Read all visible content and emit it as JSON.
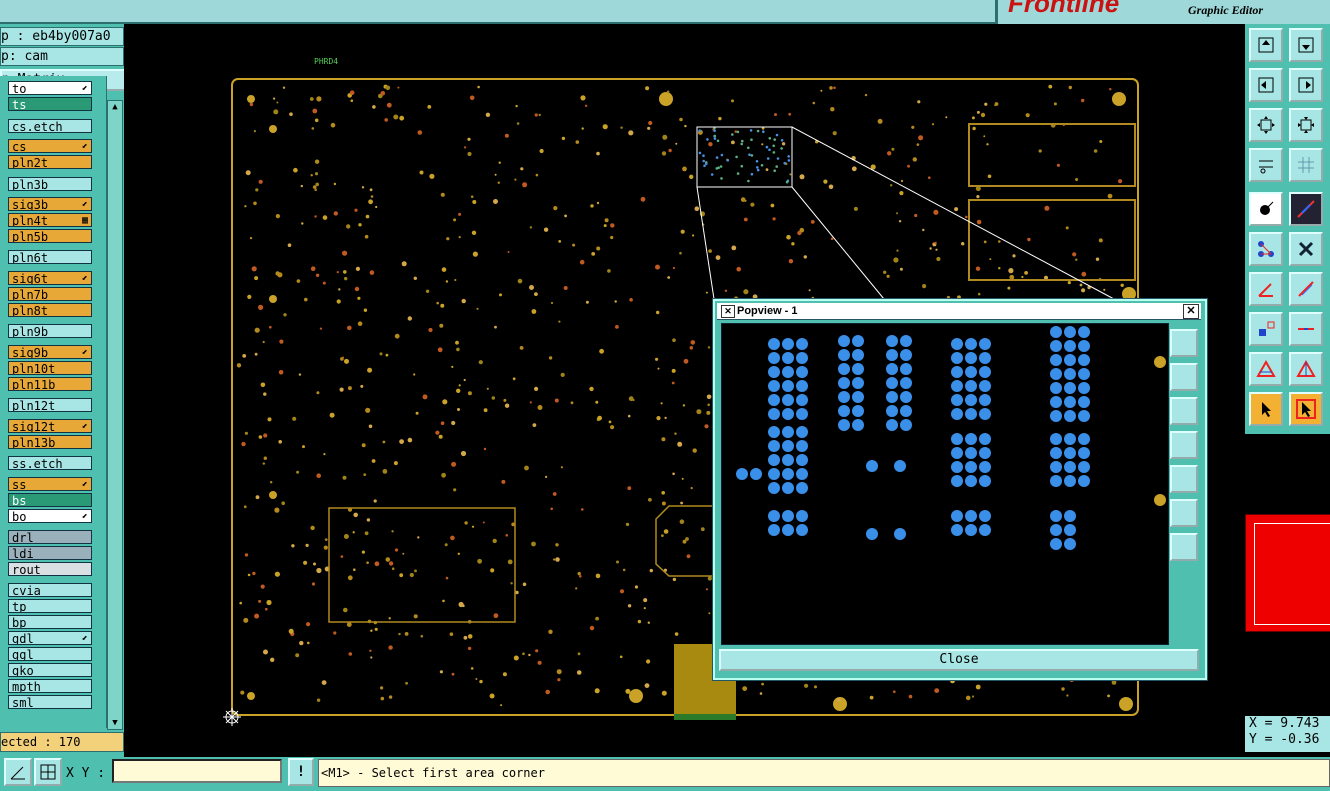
{
  "header": {
    "job_line": "p : eb4by007a0",
    "step_line": "p: cam",
    "matrix_button": "p Matrix ...",
    "brand_sub": "Graphic Editor",
    "brand_logo": "Frontline"
  },
  "layers": [
    {
      "name": "to",
      "style": "lw",
      "mark": "⬋"
    },
    {
      "name": "ts",
      "style": "lg",
      "mark": ""
    },
    {
      "name": "cs.etch",
      "style": "lt",
      "mark": ""
    },
    {
      "name": "cs",
      "style": "ly",
      "mark": "⬋"
    },
    {
      "name": "pln2t",
      "style": "ly",
      "mark": ""
    },
    {
      "name": "pln3b",
      "style": "lt",
      "mark": ""
    },
    {
      "name": "sig3b",
      "style": "ly",
      "mark": "⬋"
    },
    {
      "name": "pln4t",
      "style": "ly",
      "mark": "▦"
    },
    {
      "name": "pln5b",
      "style": "ly",
      "mark": ""
    },
    {
      "name": "pln6t",
      "style": "lt",
      "mark": ""
    },
    {
      "name": "sig6t",
      "style": "ly",
      "mark": "⬋"
    },
    {
      "name": "pln7b",
      "style": "ly",
      "mark": ""
    },
    {
      "name": "pln8t",
      "style": "ly",
      "mark": ""
    },
    {
      "name": "pln9b",
      "style": "lt",
      "mark": ""
    },
    {
      "name": "sig9b",
      "style": "ly",
      "mark": "⬋"
    },
    {
      "name": "pln10t",
      "style": "ly",
      "mark": ""
    },
    {
      "name": "pln11b",
      "style": "ly",
      "mark": ""
    },
    {
      "name": "pln12t",
      "style": "lt",
      "mark": ""
    },
    {
      "name": "sig12t",
      "style": "ly",
      "mark": "⬋"
    },
    {
      "name": "pln13b",
      "style": "ly",
      "mark": ""
    },
    {
      "name": "ss.etch",
      "style": "lt",
      "mark": ""
    },
    {
      "name": "ss",
      "style": "ly",
      "mark": "⬋"
    },
    {
      "name": "bs",
      "style": "lg",
      "mark": ""
    },
    {
      "name": "bo",
      "style": "lw",
      "mark": "⬋"
    },
    {
      "name": "drl",
      "style": "lgr",
      "mark": ""
    },
    {
      "name": "ldi",
      "style": "lgr",
      "mark": ""
    },
    {
      "name": "rout",
      "style": "lpal",
      "mark": ""
    },
    {
      "name": "cvia",
      "style": "lt",
      "mark": ""
    },
    {
      "name": "tp",
      "style": "lt",
      "mark": ""
    },
    {
      "name": "bp",
      "style": "lt",
      "mark": ""
    },
    {
      "name": "gdl",
      "style": "lt",
      "mark": "⬋"
    },
    {
      "name": "ggl",
      "style": "lt",
      "mark": ""
    },
    {
      "name": "gko",
      "style": "lt",
      "mark": ""
    },
    {
      "name": "mpth",
      "style": "lt",
      "mark": ""
    },
    {
      "name": "sml",
      "style": "lt",
      "mark": ""
    }
  ],
  "selected_text": "ected : 170",
  "canvas": {
    "board_label": "PHRD4"
  },
  "coords": {
    "x": "X = 9.743",
    "y": "Y = -0.36"
  },
  "status": {
    "xy_label": "X Y :",
    "xy_value": "",
    "message": "<M1> - Select first area corner"
  },
  "popview": {
    "title": "Popview - 1",
    "close_label": "Close"
  },
  "colors": {
    "panel": "#4fbfaf",
    "light": "#a8e6e6",
    "board": "#c9a227",
    "pad_blue": "#3a8fe8"
  }
}
